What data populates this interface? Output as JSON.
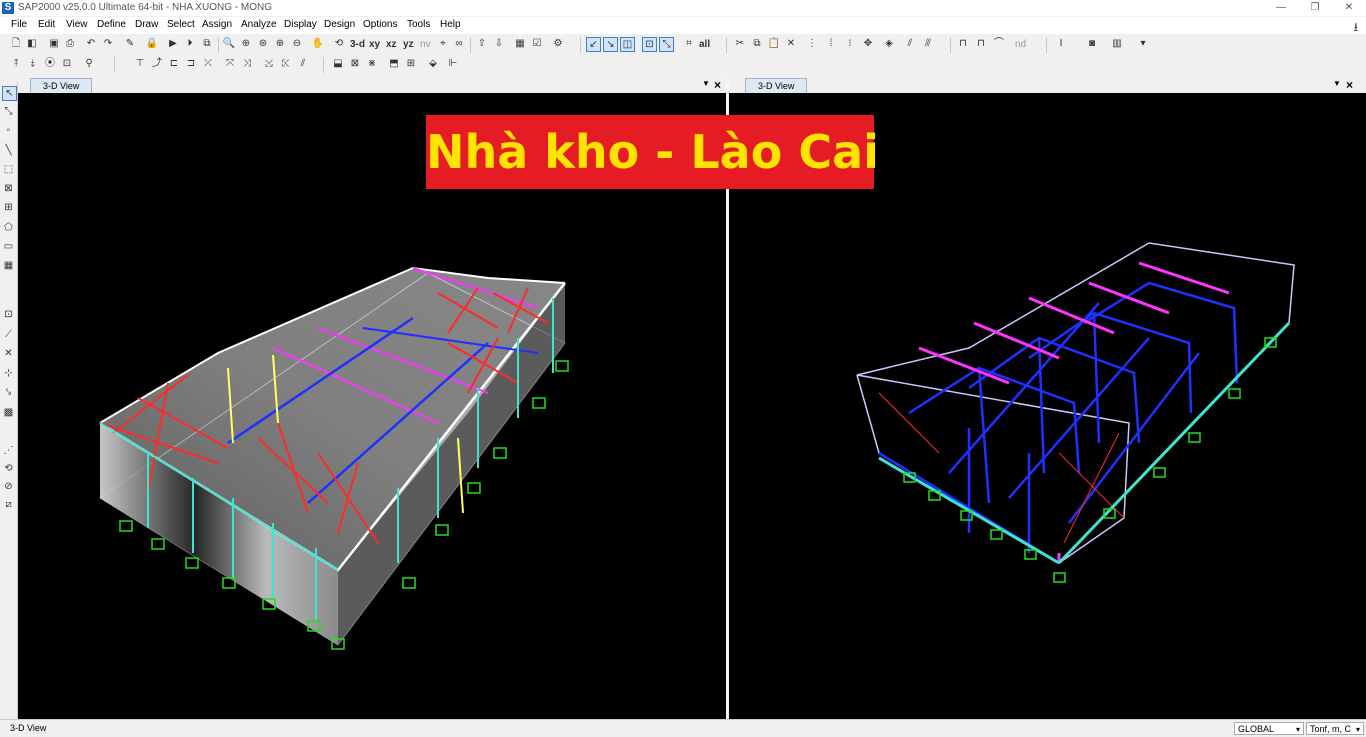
{
  "window": {
    "title": "SAP2000 v25.0.0 Ultimate 64-bit - NHA XUONG - MONG",
    "app_icon_letter": "S",
    "minimize": "—",
    "maximize": "❐",
    "close": "✕"
  },
  "menu": [
    "File",
    "Edit",
    "View",
    "Define",
    "Draw",
    "Select",
    "Assign",
    "Analyze",
    "Display",
    "Design",
    "Options",
    "Tools",
    "Help"
  ],
  "toolbar": {
    "view_3d": "3-d",
    "view_xy": "xy",
    "view_xz": "xz",
    "view_yz": "yz",
    "view_nv": "nv",
    "select_all": "all",
    "nd": "nd"
  },
  "panes": {
    "left_tab": "3-D View",
    "right_tab": "3-D View"
  },
  "banner": {
    "text": "Nhà kho - Lào Cai"
  },
  "status": {
    "left_text": "3-D View",
    "coord_system": "GLOBAL",
    "units": "Tonf, m, C"
  },
  "colors": {
    "viewport_bg": "#000000",
    "banner_bg": "#e61c24",
    "banner_text": "#ffe400",
    "brace_red": "#ff2a2a",
    "member_cyan": "#3fe3d0",
    "member_magenta": "#ff33ff",
    "member_blue": "#2030ff",
    "member_yellow": "#ffff60",
    "support_green": "#22dd22"
  }
}
